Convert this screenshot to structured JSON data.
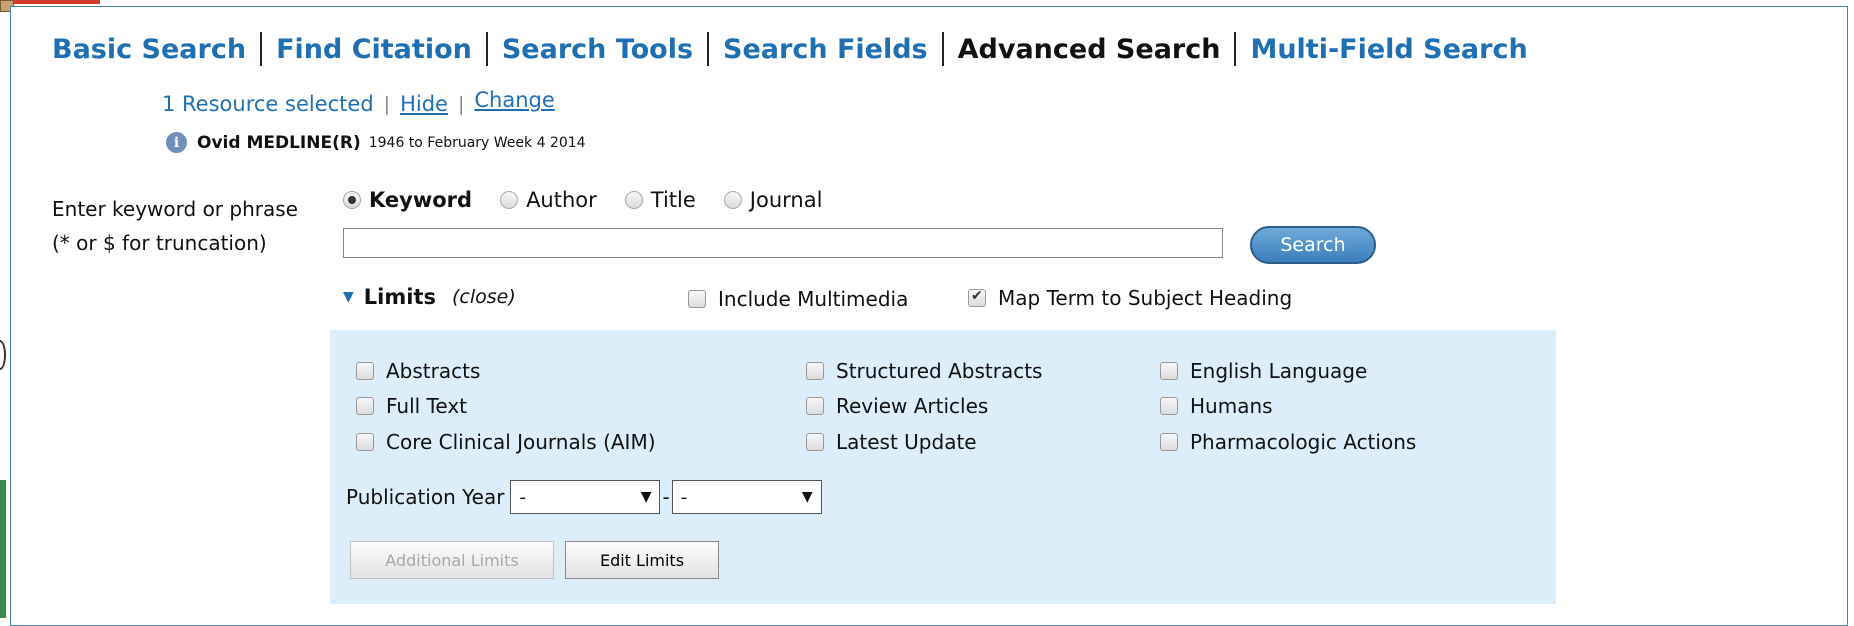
{
  "tabs": [
    "Basic Search",
    "Find Citation",
    "Search Tools",
    "Search Fields",
    "Advanced Search",
    "Multi-Field Search"
  ],
  "resource": {
    "selected_text": "1 Resource selected",
    "sep": "|",
    "hide": "Hide",
    "change": "Change",
    "info_icon_glyph": "i",
    "db_name": "Ovid MEDLINE(R)",
    "db_range": "1946 to February Week 4 2014"
  },
  "search": {
    "enter_label": "Enter keyword or phrase",
    "trunc_label": "(* or $ for truncation)",
    "radios": [
      "Keyword",
      "Author",
      "Title",
      "Journal"
    ],
    "selected_radio": "Keyword",
    "query_value": "",
    "search_button": "Search"
  },
  "limits": {
    "title": "Limits",
    "close": "(close)",
    "include_multimedia": "Include Multimedia",
    "map_term": "Map Term to Subject Heading",
    "map_term_checked": true,
    "col1": [
      "Abstracts",
      "Full Text",
      "Core Clinical Journals (AIM)"
    ],
    "col2": [
      "Structured Abstracts",
      "Review Articles",
      "Latest Update"
    ],
    "col3": [
      "English Language",
      "Humans",
      "Pharmacologic Actions"
    ],
    "pub_year_label": "Publication Year",
    "year_from": "-",
    "year_to": "-",
    "year_sep": "-",
    "additional_limits": "Additional Limits",
    "edit_limits": "Edit Limits"
  },
  "colors": {
    "link": "#1f6fb3",
    "limits_bg": "#dbeefa",
    "search_btn": "#4a8cc8"
  }
}
